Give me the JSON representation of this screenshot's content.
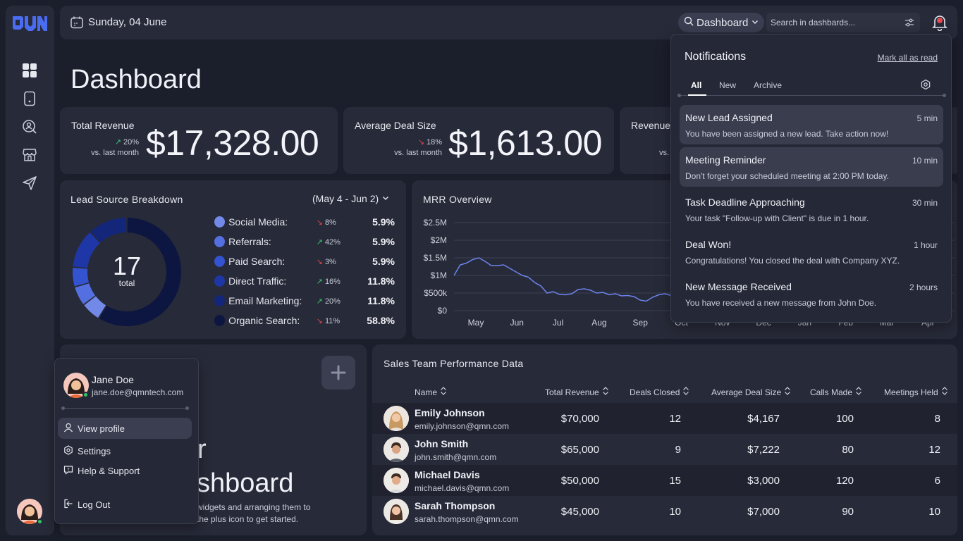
{
  "topbar": {
    "date": "Sunday, 04 June",
    "dashboard_select": "Dashboard",
    "search_placeholder": "Search in dashbards..."
  },
  "page_title": "Dashboard",
  "stats": [
    {
      "title": "Total Revenue",
      "value": "$17,328.00",
      "delta": "20%",
      "trend": "up",
      "sub": "vs. last month"
    },
    {
      "title": "Average Deal Size",
      "value": "$1,613.00",
      "delta": "18%",
      "trend": "down",
      "sub": "vs. last month"
    },
    {
      "title": "Revenue",
      "sub": "vs."
    }
  ],
  "lead_source": {
    "title": "Lead Source Breakdown",
    "range": "(May 4 - Jun 2)",
    "total_value": "17",
    "total_label": "total",
    "items": [
      {
        "label": "Social Media:",
        "delta": "8%",
        "trend": "down",
        "value": "5.9%",
        "color": "#7289e8"
      },
      {
        "label": "Referrals:",
        "delta": "42%",
        "trend": "up",
        "value": "5.9%",
        "color": "#5470e0"
      },
      {
        "label": "Paid Search:",
        "delta": "3%",
        "trend": "down",
        "value": "5.9%",
        "color": "#3453d1"
      },
      {
        "label": "Direct Traffic:",
        "delta": "16%",
        "trend": "up",
        "value": "11.8%",
        "color": "#1f37a6"
      },
      {
        "label": "Email Marketing:",
        "delta": "20%",
        "trend": "up",
        "value": "11.8%",
        "color": "#14267a"
      },
      {
        "label": "Organic Search:",
        "delta": "11%",
        "trend": "down",
        "value": "58.8%",
        "color": "#0d1640"
      }
    ]
  },
  "mrr": {
    "title": "MRR Overview",
    "y_ticks": [
      "$2.5M",
      "$2M",
      "$1.5M",
      "$1M",
      "$500k",
      "$0"
    ],
    "x_ticks": [
      "May",
      "Jun",
      "Jul",
      "Aug",
      "Sep"
    ],
    "x_ticks_partial": [
      "Oct",
      "Nov",
      "Dec",
      "Jan",
      "Feb",
      "Mar",
      "Apr"
    ]
  },
  "chart_data": {
    "type": "line",
    "title": "MRR Overview",
    "x": [
      "May",
      "Jun",
      "Jul",
      "Aug",
      "Sep",
      "Oct",
      "Nov",
      "Dec",
      "Jan",
      "Feb",
      "Mar",
      "Apr"
    ],
    "ylim": [
      0,
      2500000
    ],
    "series": [
      {
        "values": [
          1000000,
          1300000,
          1350000,
          1450000,
          1500000,
          1400000,
          1280000,
          1280000,
          1300000,
          1200000,
          1100000,
          1000000,
          950000,
          800000,
          700000,
          500000,
          540000,
          460000,
          450000,
          480000,
          600000,
          620000,
          580000,
          500000,
          520000,
          450000,
          480000,
          420000,
          430000,
          400000,
          300000,
          270000,
          380000,
          450000,
          480000,
          430000
        ]
      }
    ]
  },
  "notifications": {
    "title": "Notifications",
    "mark_all": "Mark all as read",
    "tabs": [
      "All",
      "New",
      "Archive"
    ],
    "items": [
      {
        "title": "New Lead Assigned",
        "time": "5 min",
        "body": "You have been assigned a new lead. Take action now!",
        "unread": true
      },
      {
        "title": "Meeting Reminder",
        "time": "10 min",
        "body": "Don't forget your scheduled meeting at 2:00 PM today.",
        "unread": true
      },
      {
        "title": "Task Deadline Approaching",
        "time": "30 min",
        "body": "Your task \"Follow-up with Client\" is due in 1 hour.",
        "unread": false
      },
      {
        "title": "Deal Won!",
        "time": "1 hour",
        "body": "Congratulations! You closed the deal with Company XYZ.",
        "unread": false
      },
      {
        "title": "New Message Received",
        "time": "2 hours",
        "body": "You have received a new message from John Doe.",
        "unread": false
      }
    ]
  },
  "profile_menu": {
    "name": "Jane Doe",
    "email": "jane.doe@qmntech.com",
    "items": [
      "View profile",
      "Settings",
      "Help & Support"
    ],
    "logout": "Log Out"
  },
  "empty_widget": {
    "title_line1": "r",
    "title_line2": "shboard",
    "desc_line1": "widgets and arranging them to",
    "desc_line2": "the plus icon to get started."
  },
  "sales_table": {
    "title": "Sales Team Performance Data",
    "columns": [
      "Name",
      "Total Revenue",
      "Deals Closed",
      "Average Deal Size",
      "Calls Made",
      "Meetings Held"
    ],
    "rows": [
      {
        "name": "Emily Johnson",
        "email": "emily.johnson@qmn.com",
        "revenue": "$70,000",
        "deals": "12",
        "avg": "$4,167",
        "calls": "100",
        "meetings": "8"
      },
      {
        "name": "John Smith",
        "email": "john.smith@qmn.com",
        "revenue": "$65,000",
        "deals": "9",
        "avg": "$7,222",
        "calls": "80",
        "meetings": "12"
      },
      {
        "name": "Michael Davis",
        "email": "michael.davis@qmn.com",
        "revenue": "$50,000",
        "deals": "15",
        "avg": "$3,000",
        "calls": "120",
        "meetings": "6"
      },
      {
        "name": "Sarah Thompson",
        "email": "sarah.thompson@qmn.com",
        "revenue": "$45,000",
        "deals": "10",
        "avg": "$7,000",
        "calls": "90",
        "meetings": "10"
      }
    ]
  }
}
